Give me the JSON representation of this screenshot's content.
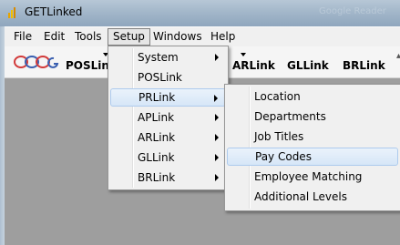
{
  "window": {
    "title": "GETLinked",
    "title_ghost": "Google Reader"
  },
  "menubar": {
    "items": [
      "File",
      "Edit",
      "Tools",
      "Setup",
      "Windows",
      "Help"
    ]
  },
  "toolbar": {
    "items": [
      "POSLink",
      "ARLink",
      "GLLink",
      "BRLink"
    ]
  },
  "setup_menu": {
    "items": [
      {
        "label": "System",
        "has_submenu": true
      },
      {
        "label": "POSLink",
        "has_submenu": false
      },
      {
        "label": "PRLink",
        "has_submenu": true
      },
      {
        "label": "APLink",
        "has_submenu": true
      },
      {
        "label": "ARLink",
        "has_submenu": true
      },
      {
        "label": "GLLink",
        "has_submenu": true
      },
      {
        "label": "BRLink",
        "has_submenu": true
      }
    ]
  },
  "prlink_menu": {
    "items": [
      "Location",
      "Departments",
      "Job Titles",
      "Pay Codes",
      "Employee Matching",
      "Additional Levels"
    ]
  },
  "colors": {
    "highlight": "#d6e6f7",
    "highlight_border": "#aecbed",
    "menu_bg": "#f0f0f0",
    "mdi_bg": "#9e9e9e"
  }
}
